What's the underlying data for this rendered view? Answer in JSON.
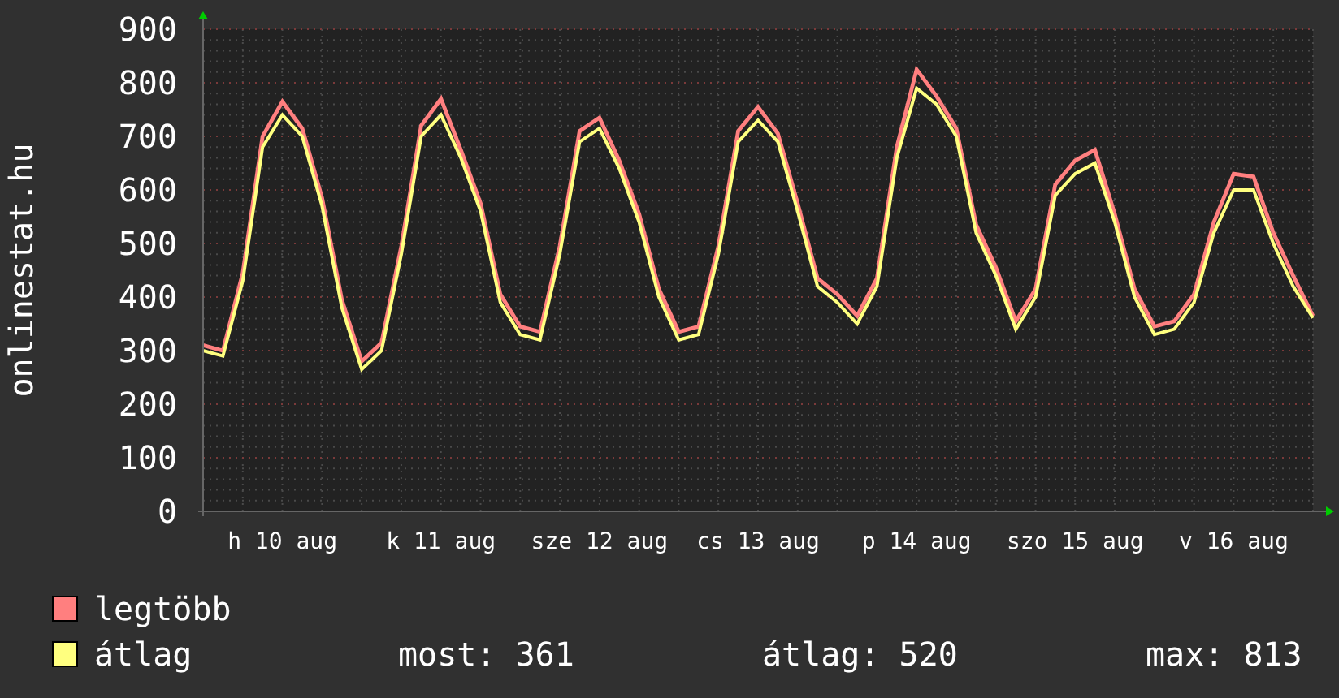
{
  "chart": {
    "ylabel": "onlinestat.hu",
    "chart_data": {
      "type": "line",
      "categories": [
        null,
        null,
        null,
        null,
        "h 10 aug",
        null,
        null,
        null,
        null,
        null,
        null,
        null,
        "k 11 aug",
        null,
        null,
        null,
        null,
        null,
        null,
        null,
        "sze 12 aug",
        null,
        null,
        null,
        null,
        null,
        null,
        null,
        "cs 13 aug",
        null,
        null,
        null,
        null,
        null,
        null,
        null,
        "p 14 aug",
        null,
        null,
        null,
        null,
        null,
        null,
        null,
        "szo 15 aug",
        null,
        null,
        null,
        null,
        null,
        null,
        null,
        "v 16 aug",
        null,
        null,
        null,
        null
      ],
      "series": [
        {
          "name": "legtöbb",
          "color": "#ff7f7f",
          "values": [
            310,
            300,
            445,
            700,
            765,
            715,
            585,
            395,
            280,
            315,
            495,
            720,
            770,
            675,
            575,
            405,
            345,
            335,
            495,
            710,
            735,
            655,
            555,
            415,
            335,
            345,
            495,
            710,
            755,
            705,
            575,
            435,
            405,
            365,
            435,
            680,
            825,
            775,
            715,
            535,
            455,
            355,
            415,
            610,
            655,
            675,
            555,
            415,
            345,
            355,
            405,
            540,
            630,
            625,
            520,
            440,
            365
          ]
        },
        {
          "name": "átlag",
          "color": "#ffff7f",
          "values": [
            300,
            290,
            430,
            680,
            740,
            700,
            570,
            380,
            265,
            300,
            480,
            700,
            740,
            660,
            560,
            390,
            330,
            320,
            480,
            690,
            715,
            640,
            540,
            400,
            320,
            330,
            480,
            690,
            730,
            690,
            560,
            420,
            390,
            350,
            420,
            660,
            790,
            760,
            700,
            520,
            440,
            340,
            400,
            590,
            630,
            650,
            540,
            400,
            330,
            340,
            390,
            520,
            600,
            600,
            500,
            420,
            361
          ]
        }
      ],
      "grid": true,
      "ylim": [
        0,
        900
      ],
      "yticks": [
        0,
        100,
        200,
        300,
        400,
        500,
        600,
        700,
        800,
        900
      ]
    }
  },
  "legend_stats": [
    "most: 361",
    "átlag: 520",
    "max: 813"
  ]
}
